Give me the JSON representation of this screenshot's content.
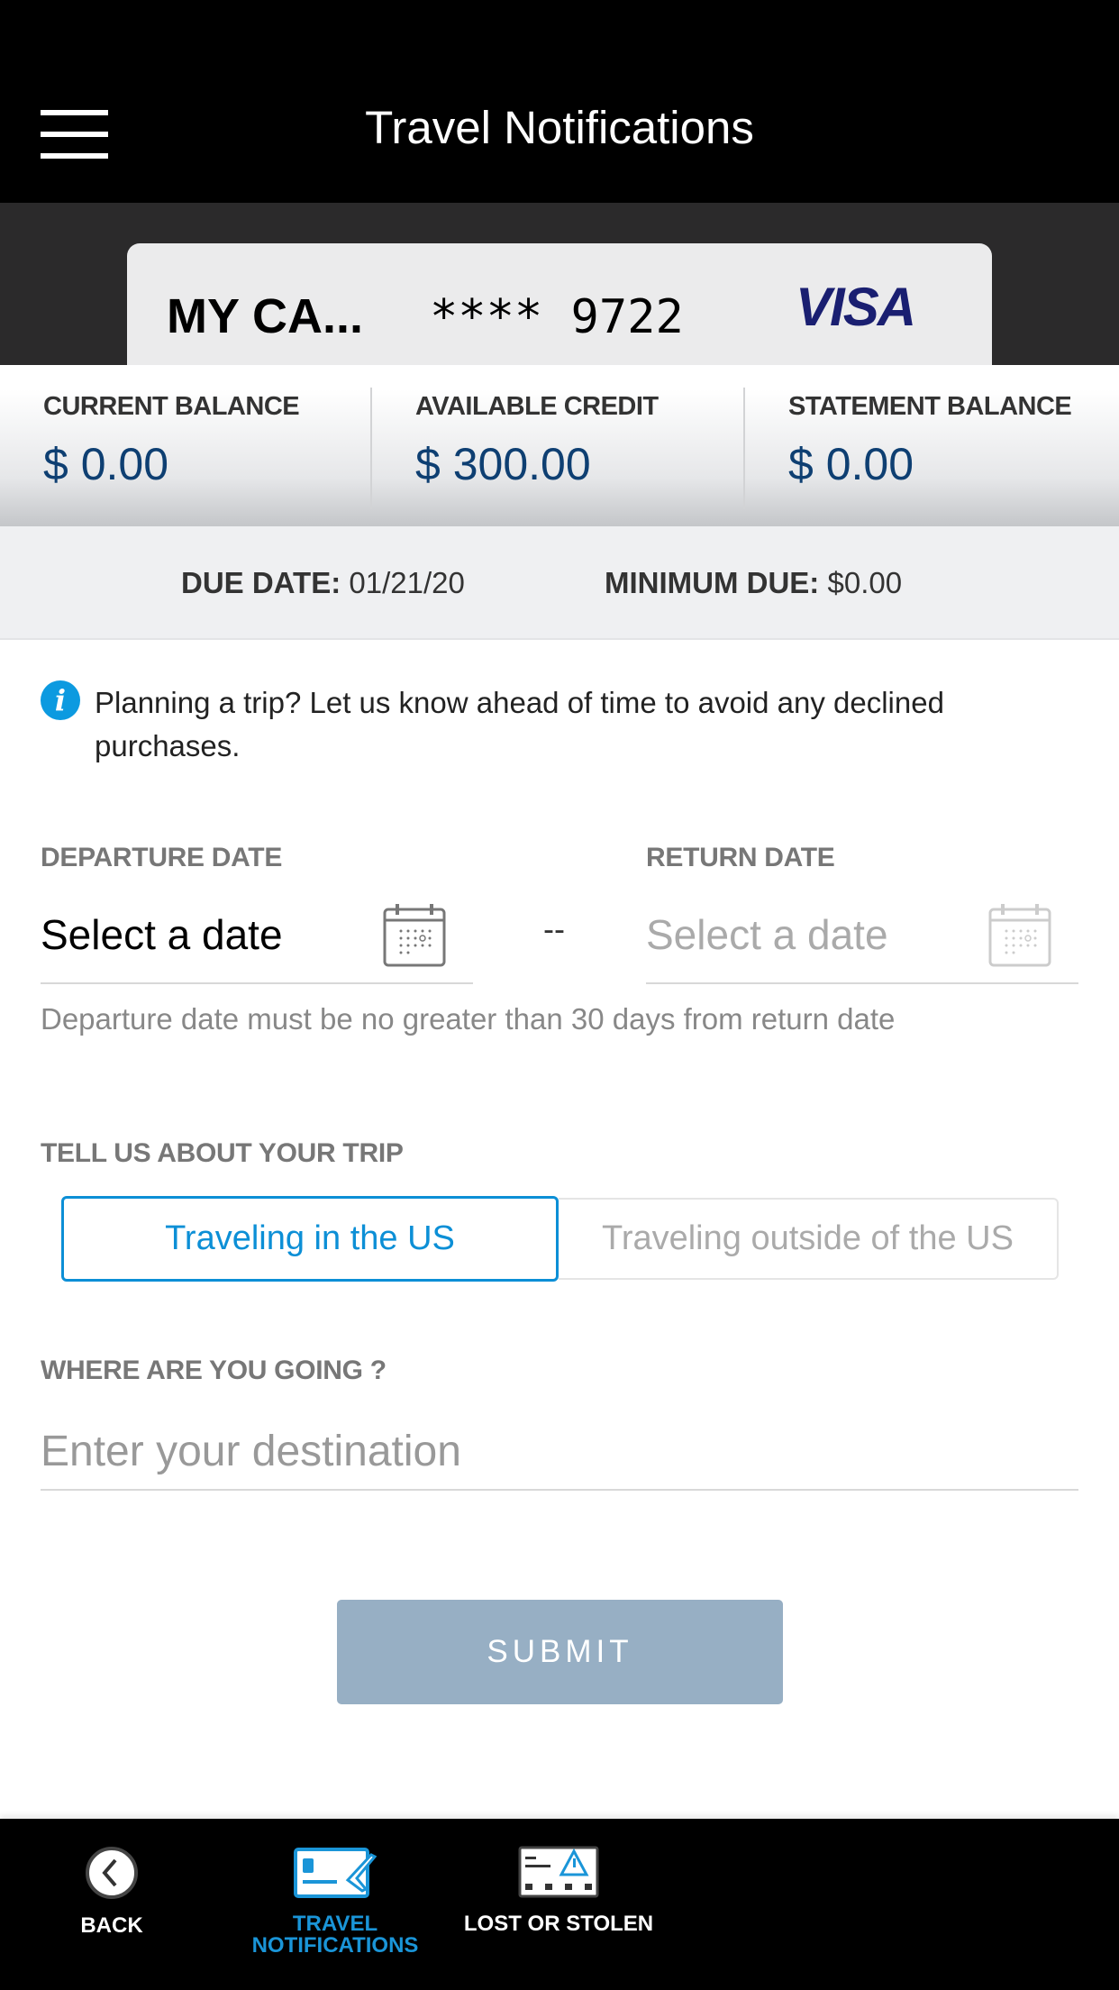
{
  "header": {
    "title": "Travel Notifications",
    "menu_icon": "hamburger-icon"
  },
  "card": {
    "name": "MY CA...",
    "number": "**** 9722",
    "brand": "VISA"
  },
  "balances": [
    {
      "label": "CURRENT BALANCE",
      "value": "$ 0.00"
    },
    {
      "label": "AVAILABLE CREDIT",
      "value": "$ 300.00"
    },
    {
      "label": "STATEMENT BALANCE",
      "value": "$ 0.00"
    }
  ],
  "due": {
    "due_label": "DUE DATE:",
    "due_value": "01/21/20",
    "min_label": "MINIMUM DUE:",
    "min_value": "$0.00"
  },
  "info": {
    "text": "Planning a trip? Let us know ahead of time to avoid any declined purchases."
  },
  "dates": {
    "departure_label": "DEPARTURE DATE",
    "departure_value": "Select a date",
    "separator": "--",
    "return_label": "RETURN DATE",
    "return_placeholder": "Select a date",
    "helper": "Departure date must be no greater than 30 days from return date"
  },
  "trip": {
    "label": "TELL US ABOUT YOUR TRIP",
    "options": [
      "Traveling in the US",
      "Traveling outside of the US"
    ],
    "selected": "Traveling in the US"
  },
  "destination": {
    "label": "WHERE ARE YOU GOING ?",
    "placeholder": "Enter your destination"
  },
  "submit_label": "SUBMIT",
  "nav": {
    "items": [
      {
        "label": "BACK"
      },
      {
        "label": "TRAVEL\nNOTIFICATIONS",
        "active": true
      },
      {
        "label": "LOST OR STOLEN"
      }
    ]
  },
  "colors": {
    "accent": "#0c8fd6",
    "balance": "#0e3f72",
    "submit": "#97afc4",
    "visa": "#1a1f71"
  }
}
